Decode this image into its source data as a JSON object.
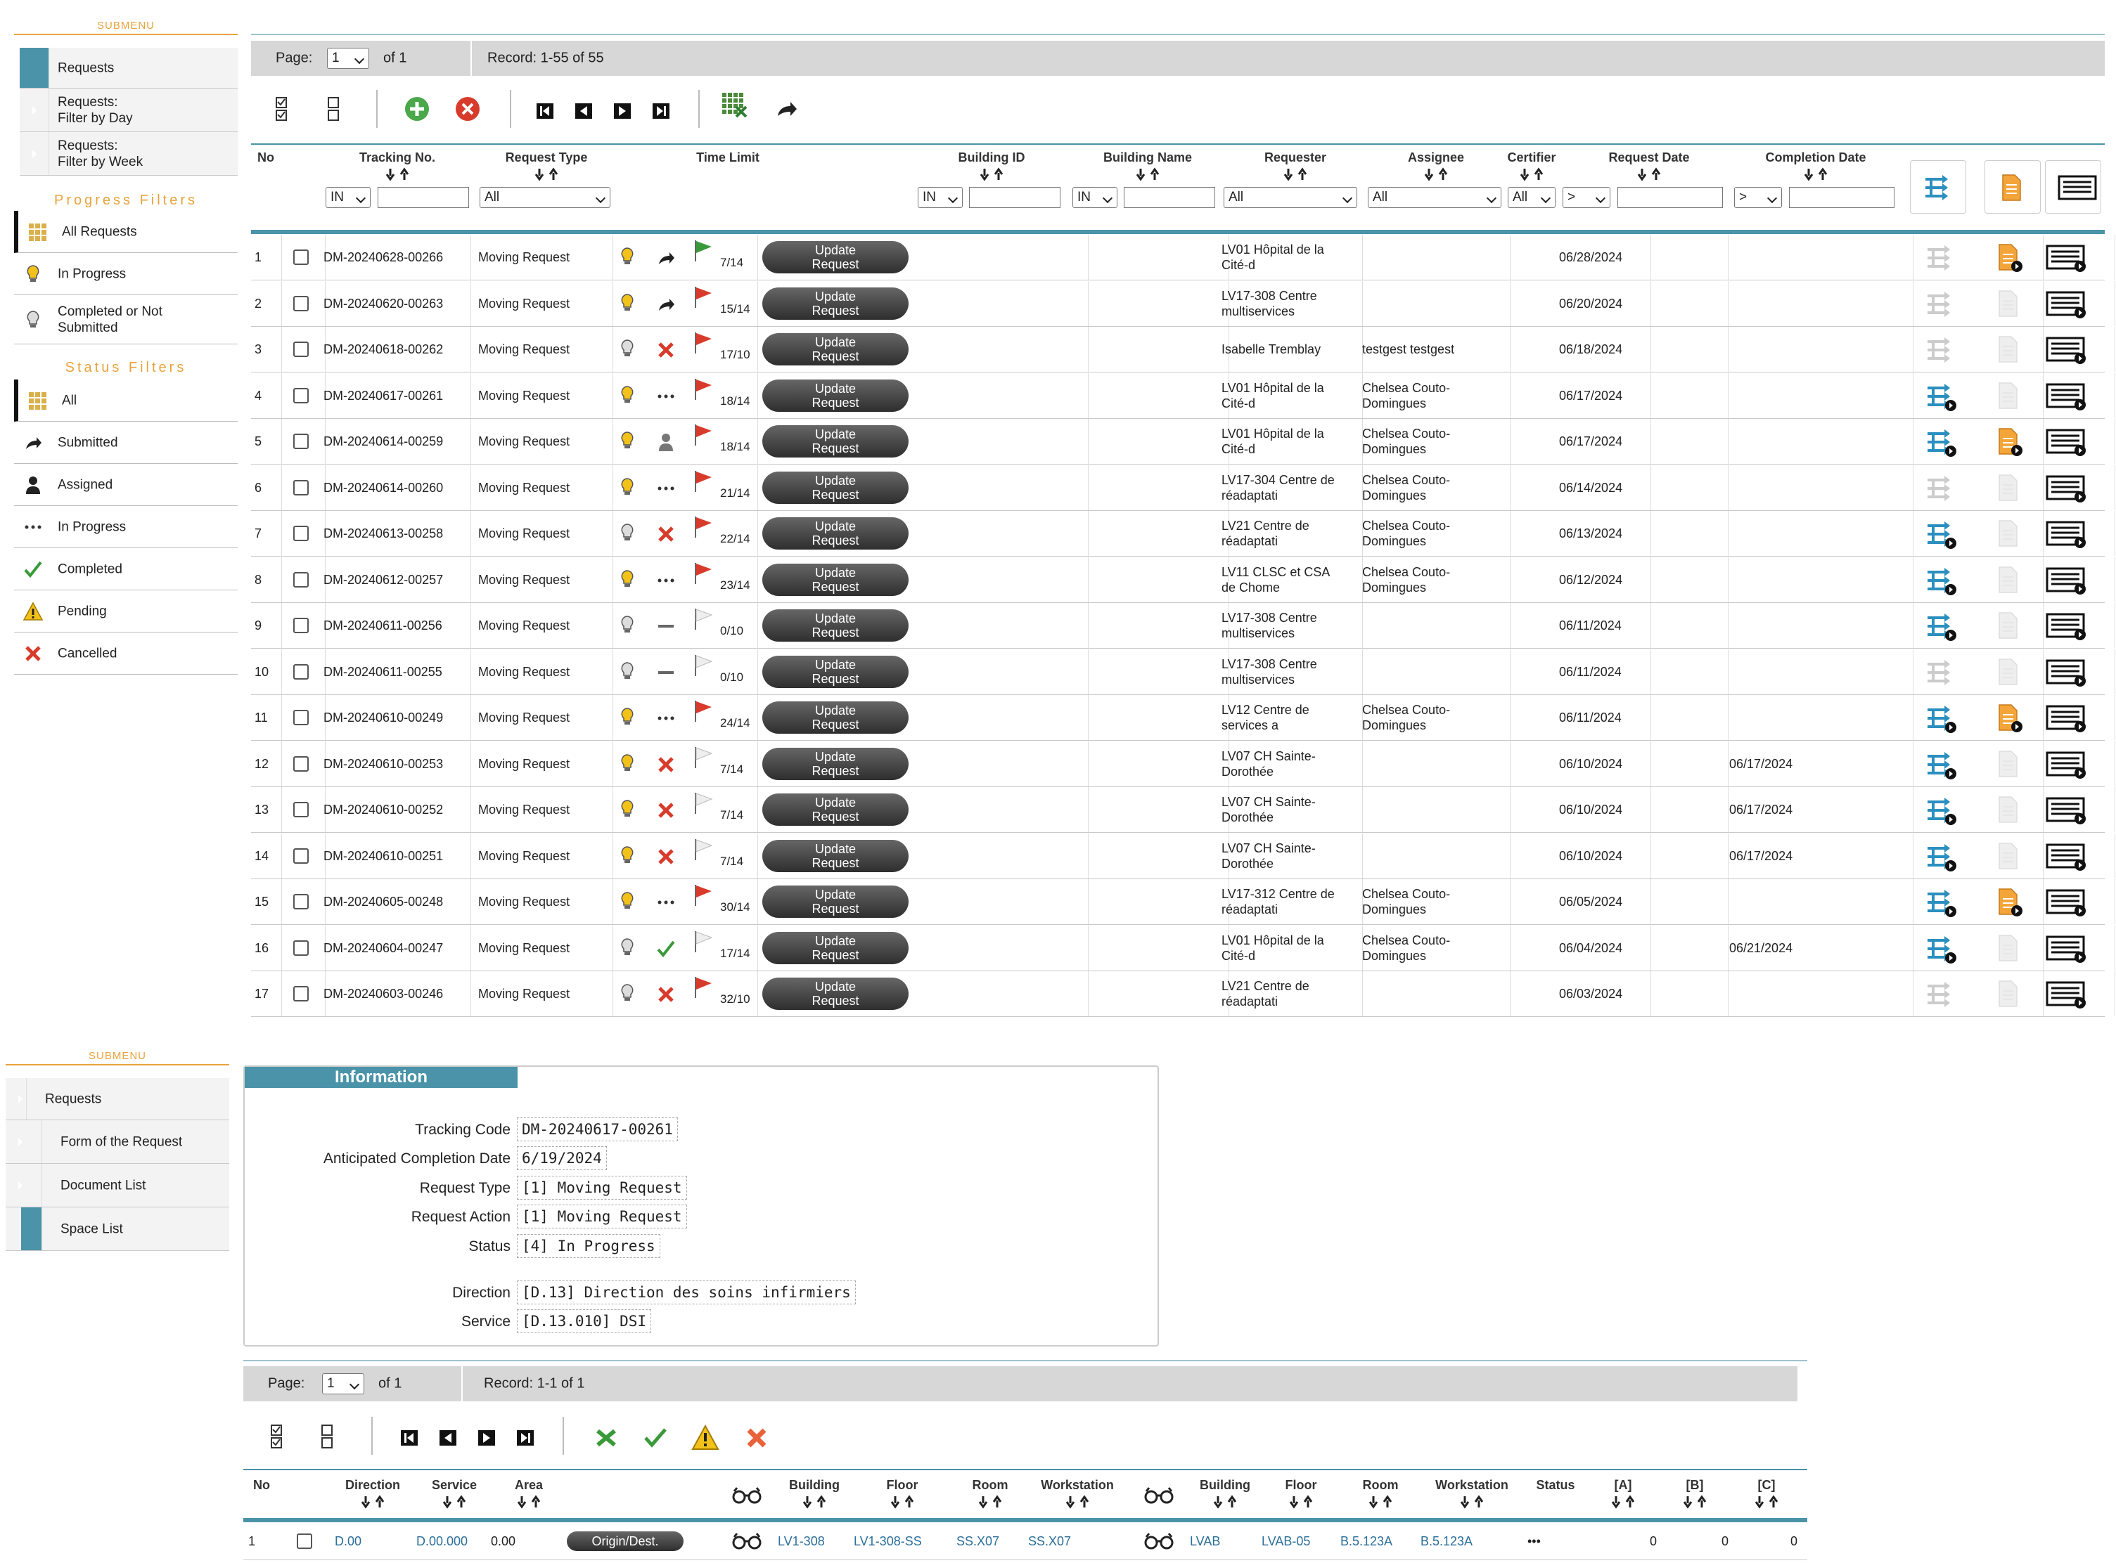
{
  "submenu1": {
    "title": "SUBMENU",
    "items": [
      {
        "label": "Requests",
        "active": true
      },
      {
        "label": "Requests:\nFilter by Day",
        "active": false
      },
      {
        "label": "Requests:\nFilter by Week",
        "active": false
      }
    ]
  },
  "progress_filters": {
    "title": "Progress Filters",
    "items": [
      {
        "label": "All Requests",
        "icon": "grid-icon"
      },
      {
        "label": "In Progress",
        "icon": "bulb-on-icon"
      },
      {
        "label": "Completed or Not\nSubmitted",
        "icon": "bulb-off-icon"
      }
    ]
  },
  "status_filters": {
    "title": "Status Filters",
    "items": [
      {
        "label": "All",
        "icon": "grid-icon"
      },
      {
        "label": "Submitted",
        "icon": "forward-arrow-icon"
      },
      {
        "label": "Assigned",
        "icon": "person-icon"
      },
      {
        "label": "In Progress",
        "icon": "dots-icon"
      },
      {
        "label": "Completed",
        "icon": "check-icon"
      },
      {
        "label": "Pending",
        "icon": "warning-icon"
      },
      {
        "label": "Cancelled",
        "icon": "x-icon"
      }
    ]
  },
  "pager1": {
    "page_label": "Page:",
    "page_value": "1",
    "of": "of 1",
    "record": "Record: 1-55 of 55"
  },
  "columns1": {
    "no": "No",
    "tracking": "Tracking No.",
    "request_type": "Request Type",
    "time_limit": "Time Limit",
    "building_id": "Building ID",
    "building_name": "Building Name",
    "requester": "Requester",
    "assignee": "Assignee",
    "certifier": "Certifier",
    "request_date": "Request Date",
    "completion_date": "Completion Date"
  },
  "filters1": {
    "in": "IN",
    "all": "All",
    "gt": ">"
  },
  "update_label": "Update\nRequest",
  "rows": [
    {
      "no": "1",
      "tracking": "DM-20240628-00266",
      "type": "Moving Request",
      "bulb": "on",
      "status": "submitted",
      "flag": "green",
      "limit": "7/14",
      "requester": "LV01 Hôpital de la\nCité-d",
      "assignee": "",
      "req_date": "06/28/2024",
      "comp_date": "",
      "blue": false,
      "doc": true
    },
    {
      "no": "2",
      "tracking": "DM-20240620-00263",
      "type": "Moving Request",
      "bulb": "on",
      "status": "submitted",
      "flag": "red",
      "limit": "15/14",
      "requester": "LV17-308 Centre\nmultiservices",
      "assignee": "",
      "req_date": "06/20/2024",
      "comp_date": "",
      "blue": false,
      "doc": false
    },
    {
      "no": "3",
      "tracking": "DM-20240618-00262",
      "type": "Moving Request",
      "bulb": "off",
      "status": "cancelled",
      "flag": "red",
      "limit": "17/10",
      "requester": "Isabelle Tremblay",
      "assignee": "testgest testgest",
      "req_date": "06/18/2024",
      "comp_date": "",
      "blue": false,
      "doc": false
    },
    {
      "no": "4",
      "tracking": "DM-20240617-00261",
      "type": "Moving Request",
      "bulb": "on",
      "status": "progress",
      "flag": "red",
      "limit": "18/14",
      "requester": "LV01 Hôpital de la\nCité-d",
      "assignee": "Chelsea Couto-\nDomingues",
      "req_date": "06/17/2024",
      "comp_date": "",
      "blue": true,
      "doc": false
    },
    {
      "no": "5",
      "tracking": "DM-20240614-00259",
      "type": "Moving Request",
      "bulb": "on",
      "status": "assigned",
      "flag": "red",
      "limit": "18/14",
      "requester": "LV01 Hôpital de la\nCité-d",
      "assignee": "Chelsea Couto-\nDomingues",
      "req_date": "06/17/2024",
      "comp_date": "",
      "blue": true,
      "doc": true
    },
    {
      "no": "6",
      "tracking": "DM-20240614-00260",
      "type": "Moving Request",
      "bulb": "on",
      "status": "progress",
      "flag": "red",
      "limit": "21/14",
      "requester": "LV17-304 Centre de\nréadaptati",
      "assignee": "Chelsea Couto-\nDomingues",
      "req_date": "06/14/2024",
      "comp_date": "",
      "blue": false,
      "doc": false
    },
    {
      "no": "7",
      "tracking": "DM-20240613-00258",
      "type": "Moving Request",
      "bulb": "off",
      "status": "cancelled",
      "flag": "red",
      "limit": "22/14",
      "requester": "LV21 Centre de\nréadaptati",
      "assignee": "Chelsea Couto-\nDomingues",
      "req_date": "06/13/2024",
      "comp_date": "",
      "blue": true,
      "doc": false
    },
    {
      "no": "8",
      "tracking": "DM-20240612-00257",
      "type": "Moving Request",
      "bulb": "on",
      "status": "progress",
      "flag": "red",
      "limit": "23/14",
      "requester": "LV11 CLSC et CSA\nde Chome",
      "assignee": "Chelsea Couto-\nDomingues",
      "req_date": "06/12/2024",
      "comp_date": "",
      "blue": true,
      "doc": false
    },
    {
      "no": "9",
      "tracking": "DM-20240611-00256",
      "type": "Moving Request",
      "bulb": "off",
      "status": "dash",
      "flag": "white",
      "limit": "0/10",
      "requester": "LV17-308 Centre\nmultiservices",
      "assignee": "",
      "req_date": "06/11/2024",
      "comp_date": "",
      "blue": true,
      "doc": false
    },
    {
      "no": "10",
      "tracking": "DM-20240611-00255",
      "type": "Moving Request",
      "bulb": "off",
      "status": "dash",
      "flag": "white",
      "limit": "0/10",
      "requester": "LV17-308 Centre\nmultiservices",
      "assignee": "",
      "req_date": "06/11/2024",
      "comp_date": "",
      "blue": false,
      "doc": false
    },
    {
      "no": "11",
      "tracking": "DM-20240610-00249",
      "type": "Moving Request",
      "bulb": "on",
      "status": "progress",
      "flag": "red",
      "limit": "24/14",
      "requester": "LV12 Centre de\nservices a",
      "assignee": "Chelsea Couto-\nDomingues",
      "req_date": "06/11/2024",
      "comp_date": "",
      "blue": true,
      "doc": true
    },
    {
      "no": "12",
      "tracking": "DM-20240610-00253",
      "type": "Moving Request",
      "bulb": "on",
      "status": "cancelled",
      "flag": "white",
      "limit": "7/14",
      "requester": "LV07 CH Sainte-\nDorothée",
      "assignee": "",
      "req_date": "06/10/2024",
      "comp_date": "06/17/2024",
      "blue": true,
      "doc": false
    },
    {
      "no": "13",
      "tracking": "DM-20240610-00252",
      "type": "Moving Request",
      "bulb": "on",
      "status": "cancelled",
      "flag": "white",
      "limit": "7/14",
      "requester": "LV07 CH Sainte-\nDorothée",
      "assignee": "",
      "req_date": "06/10/2024",
      "comp_date": "06/17/2024",
      "blue": true,
      "doc": false
    },
    {
      "no": "14",
      "tracking": "DM-20240610-00251",
      "type": "Moving Request",
      "bulb": "on",
      "status": "cancelled",
      "flag": "white",
      "limit": "7/14",
      "requester": "LV07 CH Sainte-\nDorothée",
      "assignee": "",
      "req_date": "06/10/2024",
      "comp_date": "06/17/2024",
      "blue": true,
      "doc": false
    },
    {
      "no": "15",
      "tracking": "DM-20240605-00248",
      "type": "Moving Request",
      "bulb": "on",
      "status": "progress",
      "flag": "red",
      "limit": "30/14",
      "requester": "LV17-312 Centre de\nréadaptati",
      "assignee": "Chelsea Couto-\nDomingues",
      "req_date": "06/05/2024",
      "comp_date": "",
      "blue": true,
      "doc": true
    },
    {
      "no": "16",
      "tracking": "DM-20240604-00247",
      "type": "Moving Request",
      "bulb": "off",
      "status": "completed",
      "flag": "white",
      "limit": "17/14",
      "requester": "LV01 Hôpital de la\nCité-d",
      "assignee": "Chelsea Couto-\nDomingues",
      "req_date": "06/04/2024",
      "comp_date": "06/21/2024",
      "blue": true,
      "doc": false
    },
    {
      "no": "17",
      "tracking": "DM-20240603-00246",
      "type": "Moving Request",
      "bulb": "off",
      "status": "cancelled",
      "flag": "red",
      "limit": "32/10",
      "requester": "LV21 Centre de\nréadaptati",
      "assignee": "",
      "req_date": "06/03/2024",
      "comp_date": "",
      "blue": false,
      "doc": false
    }
  ],
  "submenu2": {
    "title": "SUBMENU",
    "items": [
      {
        "label": "Requests",
        "active": false
      },
      {
        "label": "Form of the Request",
        "active": false
      },
      {
        "label": "Document List",
        "active": false
      },
      {
        "label": "Space List",
        "active": true
      }
    ]
  },
  "info": {
    "title": "Information",
    "fields": [
      {
        "label": "Tracking Code",
        "value": "DM-20240617-00261"
      },
      {
        "label": "Anticipated Completion Date",
        "value": "6/19/2024"
      },
      {
        "label": "Request Type",
        "value": "[1] Moving Request"
      },
      {
        "label": "Request Action",
        "value": "[1] Moving Request"
      },
      {
        "label": "Status",
        "value": "[4] In Progress"
      },
      {
        "label": "Direction",
        "value": "[D.13] Direction des soins infirmiers"
      },
      {
        "label": "Service",
        "value": "[D.13.010] DSI"
      }
    ]
  },
  "pager2": {
    "page_label": "Page:",
    "page_value": "1",
    "of": "of 1",
    "record": "Record: 1-1 of 1"
  },
  "columns2": {
    "no": "No",
    "direction": "Direction",
    "service": "Service",
    "area": "Area",
    "building": "Building",
    "floor": "Floor",
    "room": "Room",
    "workstation": "Workstation",
    "building2": "Building",
    "floor2": "Floor",
    "room2": "Room",
    "workstation2": "Workstation",
    "status": "Status",
    "a": "[A]",
    "b": "[B]",
    "c": "[C]"
  },
  "space_row": {
    "no": "1",
    "direction": "D.00",
    "service": "D.00.000",
    "area": "0.00",
    "btn": "Origin/Dest.",
    "building": "LV1-308",
    "floor": "LV1-308-SS",
    "room": "SS.X07",
    "workstation": "SS.X07",
    "building2": "LVAB",
    "floor2": "LVAB-05",
    "room2": "B.5.123A",
    "workstation2": "B.5.123A",
    "status": "•••",
    "a": "0",
    "b": "0",
    "c": "0"
  },
  "colors": {
    "accent": "#4a93a8",
    "orange": "#e8a33a",
    "red": "#d83b2b",
    "green": "#3a9a3a",
    "bulb": "#f2c21b"
  }
}
